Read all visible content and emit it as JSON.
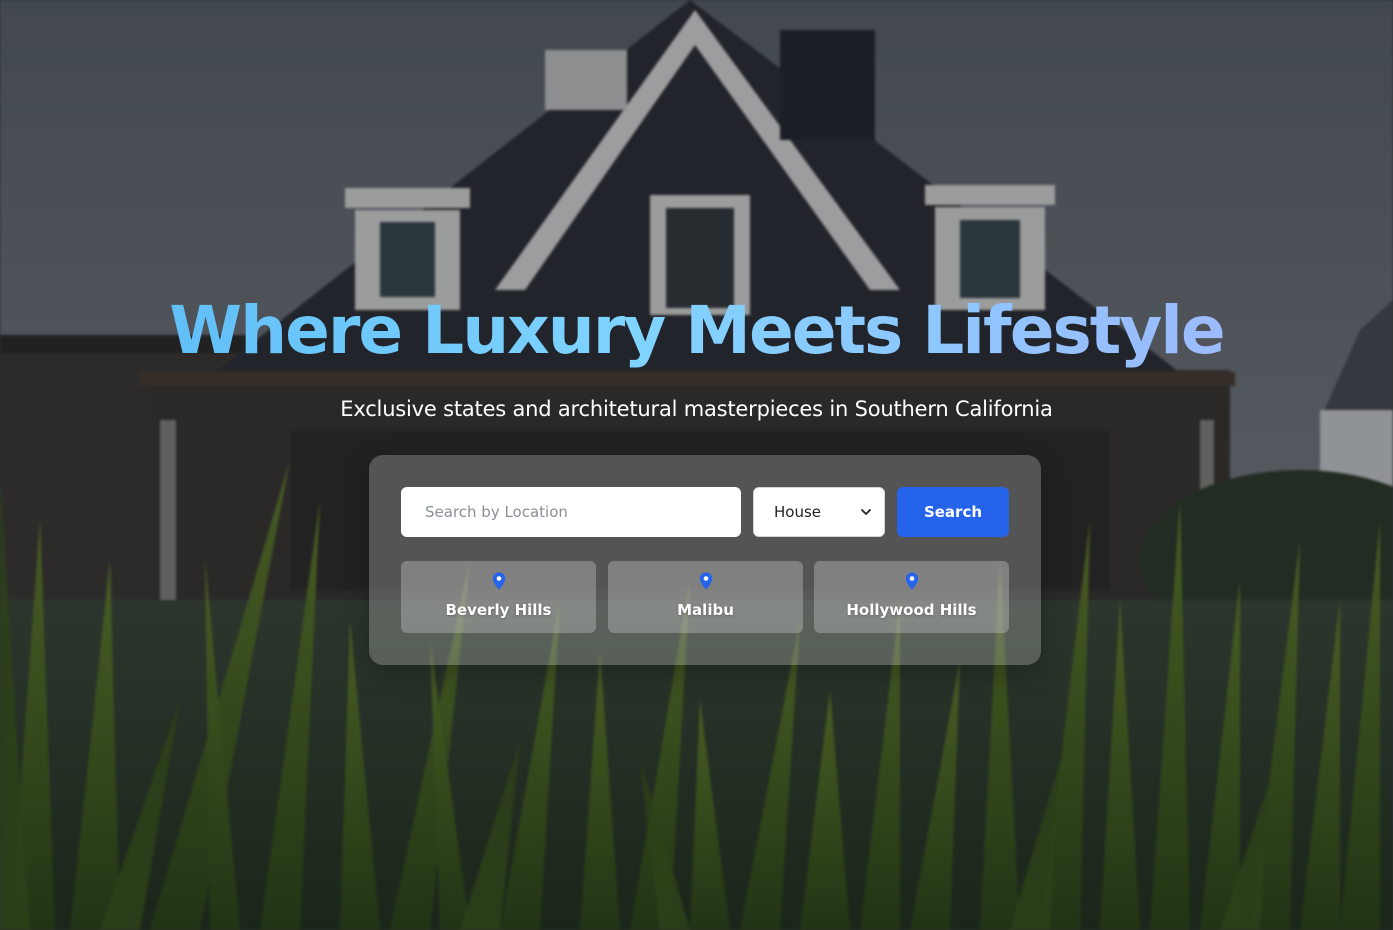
{
  "hero": {
    "title": "Where Luxury Meets Lifestyle",
    "subtitle": "Exclusive states and architetural masterpieces in Southern California"
  },
  "search": {
    "placeholder": "Search by Location",
    "value": "",
    "property_type": {
      "selected": "House"
    },
    "button_label": "Search"
  },
  "locations": [
    {
      "label": "Beverly Hills",
      "icon": "map-pin-icon"
    },
    {
      "label": "Malibu",
      "icon": "map-pin-icon"
    },
    {
      "label": "Hollywood Hills",
      "icon": "map-pin-icon"
    }
  ],
  "colors": {
    "accent": "#2563eb",
    "title_gradient_start": "#56b8f4",
    "title_gradient_end": "#a5b4fc",
    "pin": "#2563eb"
  }
}
